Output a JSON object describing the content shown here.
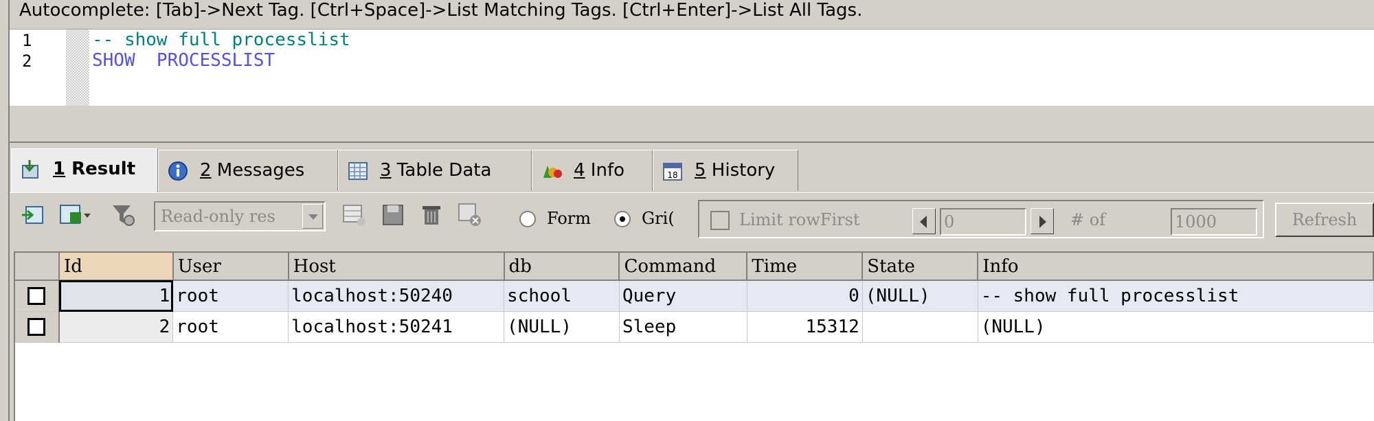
{
  "hint_bar": "Autocomplete: [Tab]->Next Tag. [Ctrl+Space]->List Matching Tags. [Ctrl+Enter]->List All Tags.",
  "editor": {
    "lines": [
      {
        "number": "1",
        "text": "-- show full processlist",
        "style": "comment"
      },
      {
        "number": "2",
        "text": "SHOW  PROCESSLIST",
        "style": "keyword"
      }
    ]
  },
  "tabs": [
    {
      "num": "1",
      "label": " Result",
      "icon": "result-icon",
      "active": true
    },
    {
      "num": "2",
      "label": " Messages",
      "icon": "info-circle-icon"
    },
    {
      "num": "3",
      "label": " Table Data",
      "icon": "table-icon"
    },
    {
      "num": "4",
      "label": " Info",
      "icon": "shapes-icon"
    },
    {
      "num": "5",
      "label": " History",
      "icon": "calendar-icon",
      "calendar_day": "18"
    }
  ],
  "toolbar": {
    "mode_combo": "Read-only res",
    "form_label": "Form",
    "grid_label": "Gri(",
    "limit_label": "Limit rowFirst",
    "first_value": "0",
    "of_label": "# of",
    "count_value": "1000",
    "refresh_label": "Refresh"
  },
  "grid": {
    "columns": [
      "Id",
      "User",
      "Host",
      "db",
      "Command",
      "Time",
      "State",
      "Info"
    ],
    "rows": [
      [
        "1",
        "root",
        "localhost:50240",
        "school",
        "Query",
        "0",
        "(NULL)",
        "-- show full processlist"
      ],
      [
        "2",
        "root",
        "localhost:50241",
        "(NULL)",
        "Sleep",
        "15312",
        "",
        "(NULL)"
      ]
    ]
  },
  "colors": {
    "comment": "#008080",
    "keyword": "#5050ff",
    "chrome": "#d4d0c8",
    "selected_row": "#e6e8f4"
  }
}
